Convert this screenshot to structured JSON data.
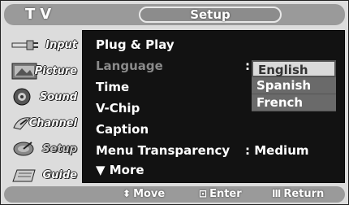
{
  "header": {
    "tv_label": "TV",
    "section_title": "Setup"
  },
  "sidebar": {
    "items": [
      {
        "label": "Input",
        "icon": "input-plug-icon",
        "active": false
      },
      {
        "label": "Picture",
        "icon": "picture-icon",
        "active": false
      },
      {
        "label": "Sound",
        "icon": "speaker-icon",
        "active": false
      },
      {
        "label": "Channel",
        "icon": "satellite-dish-icon",
        "active": false
      },
      {
        "label": "Setup",
        "icon": "setup-dish-icon",
        "active": true
      },
      {
        "label": "Guide",
        "icon": "guide-icon",
        "active": false
      }
    ]
  },
  "menu": {
    "items": [
      {
        "label": "Plug & Play",
        "dim": false,
        "value": ""
      },
      {
        "label": "Language",
        "dim": true,
        "value": ":"
      },
      {
        "label": "Time",
        "dim": false,
        "value": ""
      },
      {
        "label": "V-Chip",
        "dim": false,
        "value": ""
      },
      {
        "label": "Caption",
        "dim": false,
        "value": ""
      },
      {
        "label": "Menu Transparency",
        "dim": false,
        "value": ": Medium"
      },
      {
        "label": "▼ More",
        "dim": false,
        "value": ""
      }
    ]
  },
  "language_dropdown": {
    "options": [
      "English",
      "Spanish",
      "French"
    ],
    "selected": "English"
  },
  "footer": {
    "move": {
      "glyph": "⬍",
      "label": "Move"
    },
    "enter": {
      "glyph": "⊡",
      "label": "Enter"
    },
    "return": {
      "glyph": "Ⅲ",
      "label": "Return"
    }
  },
  "colors": {
    "panel_bg": "#121212",
    "chrome_gray": "#9a9a9a",
    "highlight": "#dadada"
  }
}
